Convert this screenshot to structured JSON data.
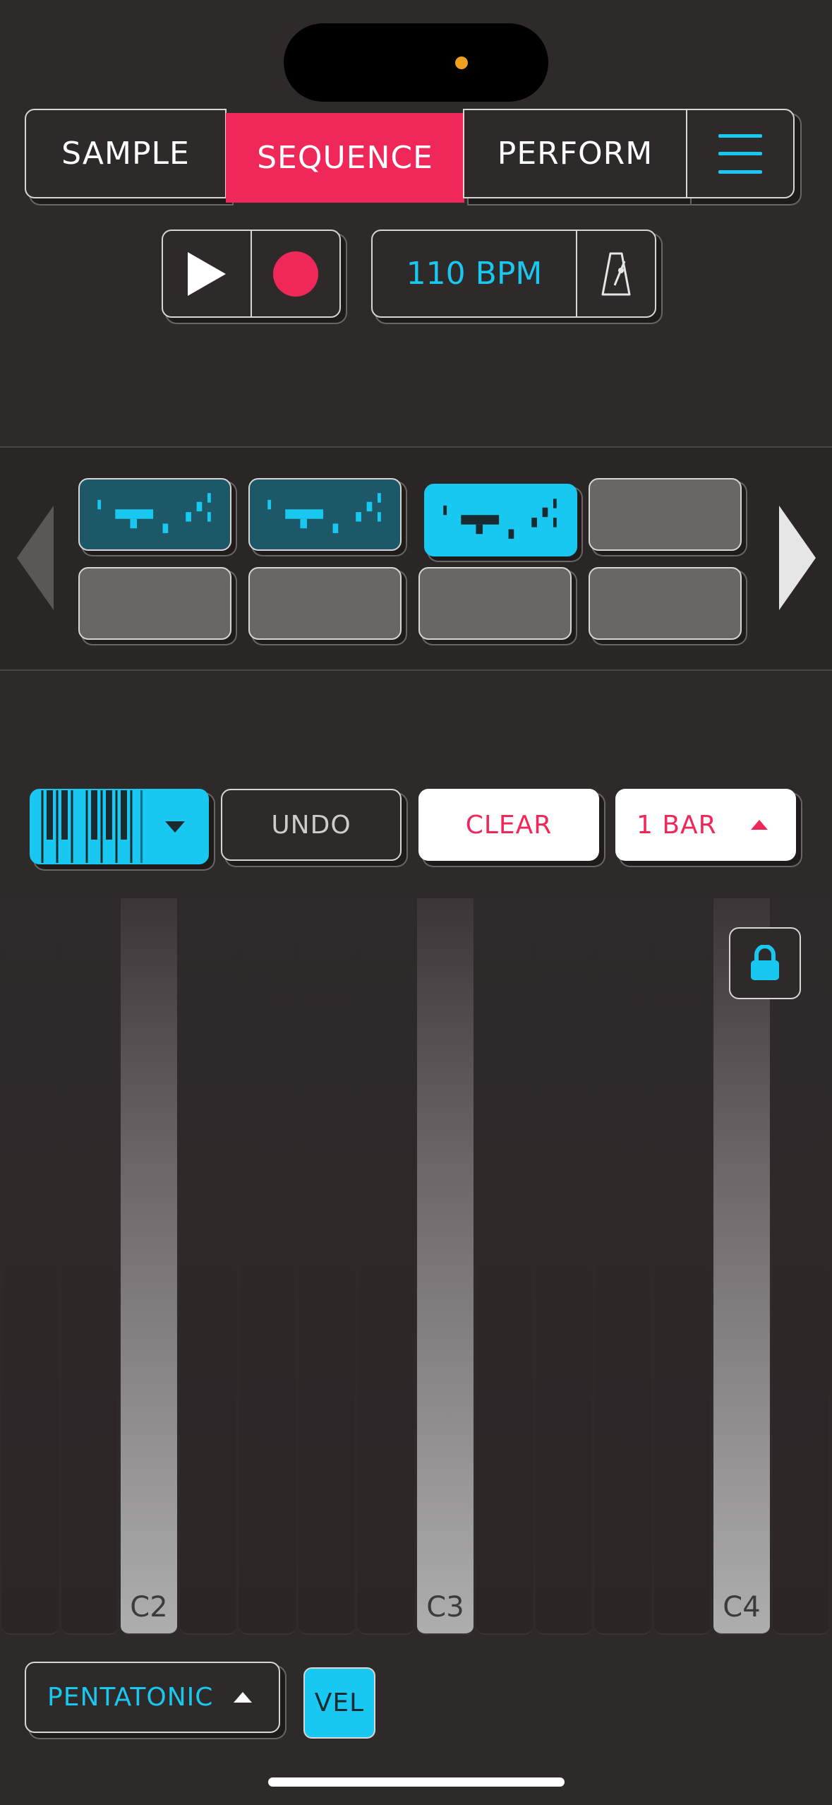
{
  "mode_tabs": {
    "sample": "SAMPLE",
    "sequence": "SEQUENCE",
    "perform": "PERFORM",
    "active": "sequence"
  },
  "transport": {
    "bpm": "110 BPM"
  },
  "controls": {
    "undo": "UNDO",
    "clear": "CLEAR",
    "bar_length": "1 BAR"
  },
  "keyboard": {
    "labels": [
      "C2",
      "C3",
      "C4"
    ]
  },
  "footer": {
    "scale": "PENTATONIC",
    "velocity": "VEL"
  },
  "colors": {
    "accent_cyan": "#19c8f0",
    "accent_pink": "#f0285a",
    "background": "#2e2a2a"
  }
}
